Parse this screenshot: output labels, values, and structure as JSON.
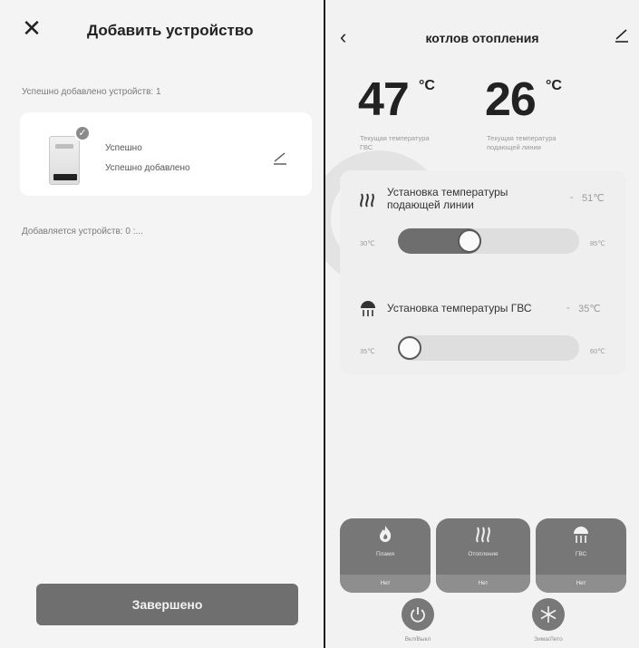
{
  "left": {
    "title": "Добавить устройство",
    "close_icon": "close-icon",
    "success_count_text": "Успешно добавлено устройств: 1",
    "device": {
      "status": "Успешно",
      "substatus": "Успешно добавлено",
      "edit_icon": "pencil-icon"
    },
    "adding_text": "Добавляется устройств: 0 :...",
    "finish_label": "Завершено"
  },
  "right": {
    "title": "котлов отопления",
    "back_icon": "chevron-left-icon",
    "edit_icon": "pencil-icon",
    "dhw_temp": {
      "value": "47",
      "unit": "°C",
      "caption": "Текущая температура ГВС"
    },
    "supply_temp": {
      "value": "26",
      "unit": "°C",
      "caption": "Текущая температура подающей линии"
    },
    "supply_setting": {
      "label_line1": "Установка температуры",
      "label_line2": "подающей линии",
      "dash": "-",
      "value": "51℃",
      "min": "30℃",
      "max": "85℃",
      "level_fraction": 0.382
    },
    "dhw_setting": {
      "label": "Установка температуры ГВС",
      "dash": "-",
      "value": "35℃",
      "min": "35℃",
      "max": "60℃",
      "level_fraction": 0.0
    },
    "modes": [
      {
        "label": "Пламя",
        "status": "Нет",
        "icon": "flame-icon"
      },
      {
        "label": "Отопление",
        "status": "Нет",
        "icon": "heating-icon"
      },
      {
        "label": "ГВС",
        "status": "Нет",
        "icon": "shower-icon"
      }
    ],
    "power_label": "Вкл/Выкл",
    "season_label": "Зима/Лето",
    "colors": {
      "tile": "#777777",
      "slider_fill": "#6e6e6e",
      "finish_button": "#6f6f6f"
    }
  }
}
